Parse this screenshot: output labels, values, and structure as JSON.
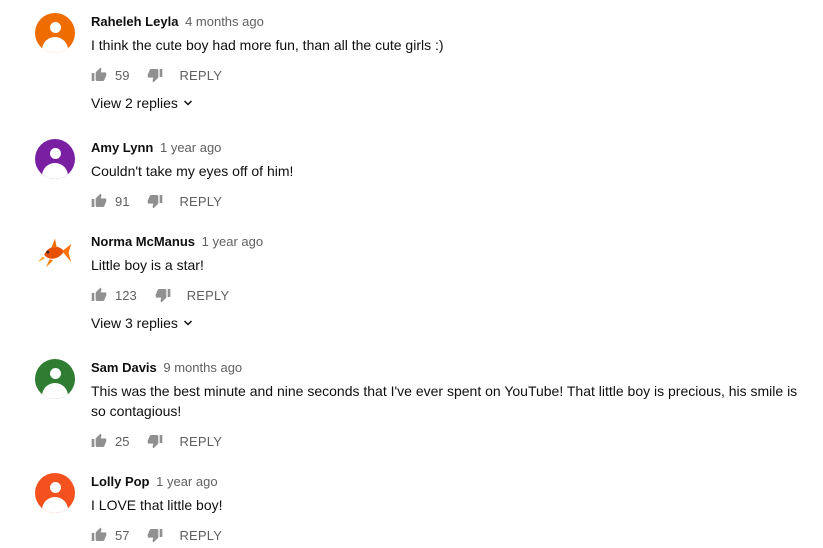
{
  "comments": [
    {
      "author": "Raheleh Leyla",
      "time": "4 months ago",
      "text": "I think the cute boy had more fun, than all the cute girls :)",
      "likes": "59",
      "reply_label": "REPLY",
      "view_replies": "View 2 replies",
      "avatar_color": "#ef6c00"
    },
    {
      "author": "Amy Lynn",
      "time": "1 year ago",
      "text": "Couldn't take my eyes off of him!",
      "likes": "91",
      "reply_label": "REPLY",
      "avatar_color": "#7b1fa2"
    },
    {
      "author": "Norma McManus",
      "time": "1 year ago",
      "text": "Little boy is a star!",
      "likes": "123",
      "reply_label": "REPLY",
      "view_replies": "View 3 replies",
      "avatar_icon": "goldfish-icon"
    },
    {
      "author": "Sam Davis",
      "time": "9 months ago",
      "text": "This was the best minute and nine seconds that I've ever spent on YouTube! That little boy is precious, his smile is so contagious!",
      "likes": "25",
      "reply_label": "REPLY",
      "avatar_color": "#2e7d32"
    },
    {
      "author": "Lolly Pop",
      "time": "1 year ago",
      "text": "I LOVE that little boy!",
      "likes": "57",
      "reply_label": "REPLY",
      "avatar_color": "#f4511e"
    }
  ]
}
